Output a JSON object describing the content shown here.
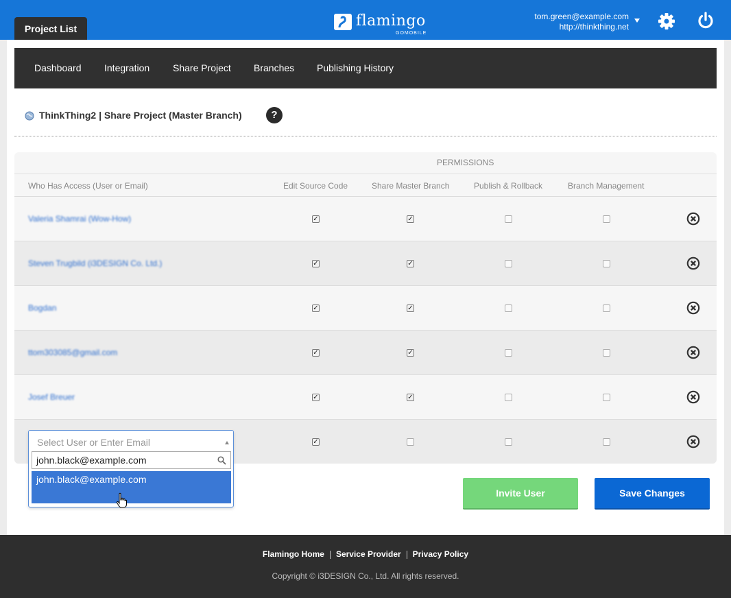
{
  "header": {
    "project_tab": "Project List",
    "logo_text": "flamingo",
    "logo_sub": "GOMOBILE",
    "account_email": "tom.green@example.com",
    "account_site": "http://thinkthing.net"
  },
  "subnav": {
    "items": [
      "Dashboard",
      "Integration",
      "Share Project",
      "Branches",
      "Publishing History"
    ]
  },
  "page": {
    "title": "ThinkThing2 | Share Project (Master Branch)",
    "help": "?"
  },
  "table": {
    "permissions_label": "PERMISSIONS",
    "columns": [
      "Who Has Access (User or Email)",
      "Edit Source Code",
      "Share Master Branch",
      "Publish & Rollback",
      "Branch Management"
    ],
    "rows": [
      {
        "user": "Valeria Shamrai (Wow-How)",
        "edit": true,
        "share": true,
        "publish": false,
        "branch": false
      },
      {
        "user": "Steven Trugbild (i3DESIGN Co. Ltd.)",
        "edit": true,
        "share": true,
        "publish": false,
        "branch": false
      },
      {
        "user": "Bogdan",
        "edit": true,
        "share": true,
        "publish": false,
        "branch": false
      },
      {
        "user": "ttom303085@gmail.com",
        "edit": true,
        "share": true,
        "publish": false,
        "branch": false
      },
      {
        "user": "Josef Breuer",
        "edit": true,
        "share": true,
        "publish": false,
        "branch": false
      },
      {
        "user": "",
        "edit": true,
        "share": false,
        "publish": false,
        "branch": false
      }
    ]
  },
  "user_select": {
    "placeholder": "Select User or Enter Email",
    "search_value": "john.black@example.com",
    "options": [
      "john.black@example.com"
    ]
  },
  "buttons": {
    "invite": "Invite User",
    "save": "Save Changes"
  },
  "footer": {
    "links": [
      "Flamingo Home",
      "Service Provider",
      "Privacy Policy"
    ],
    "copyright": "Copyright © i3DESIGN Co., Ltd. All rights reserved."
  },
  "colors": {
    "brand_blue": "#1676d8",
    "invite_green": "#75d77b",
    "save_blue": "#0b68d4"
  }
}
